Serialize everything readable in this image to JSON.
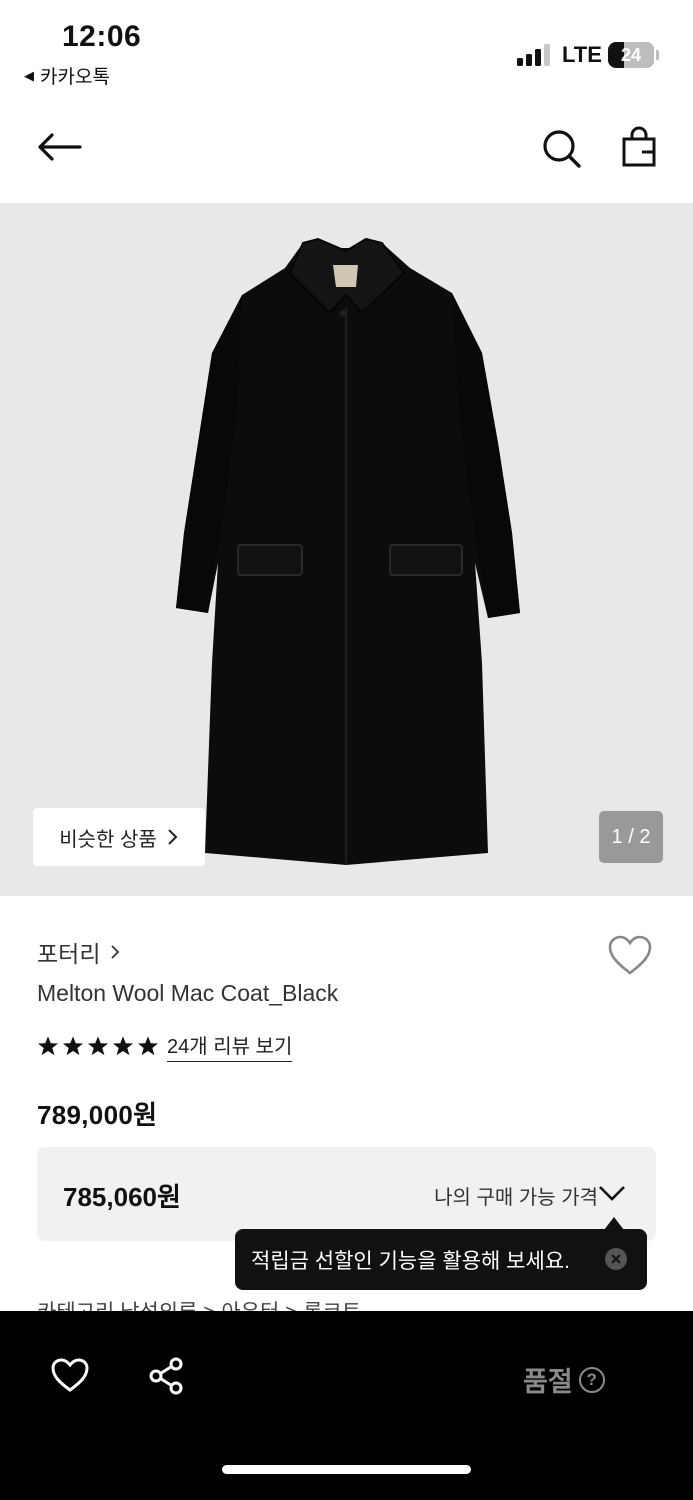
{
  "status_bar": {
    "time": "12:06",
    "back_app": "카카오톡",
    "network": "LTE",
    "battery": "24"
  },
  "nav": {
    "back_icon": "arrow-left-icon",
    "search_icon": "search-icon",
    "cart_icon": "shopping-bag-icon"
  },
  "hero": {
    "similar_label": "비슷한 상품",
    "pager": "1 / 2"
  },
  "product": {
    "brand": "포터리",
    "name": "Melton Wool Mac Coat_Black",
    "rating_stars": 5,
    "review_link": "24개 리뷰 보기",
    "price": "789,000원"
  },
  "my_price": {
    "value": "785,060원",
    "label": "나의 구매 가능 가격"
  },
  "tooltip": {
    "text": "적립금 선할인 기능을 활용해 보세요."
  },
  "breadcrumb": {
    "text": "카테고리    남성의류 > 아우터 > 롱코트"
  },
  "bottom_bar": {
    "status": "품절",
    "help": "?"
  },
  "colors": {
    "hero_bg": "#e8e8e8",
    "box_bg": "#f1f1f3",
    "bar_bg": "#000000",
    "sold_out": "#8a8a8a"
  }
}
